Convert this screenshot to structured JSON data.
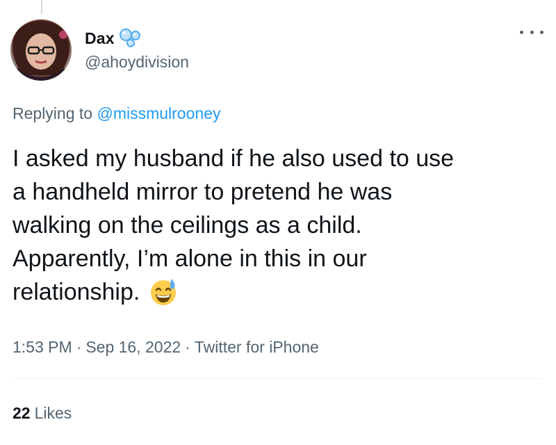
{
  "tweet": {
    "author": {
      "display_name": "Dax",
      "handle": "@ahoydivision",
      "name_emoji": "bubbles-emoji"
    },
    "more_icon": "more-horizontal-icon",
    "reply": {
      "prefix": "Replying to",
      "mention": "@missmulrooney"
    },
    "text_lines": [
      "I asked my husband if he also used to use",
      "a handheld mirror to pretend he was",
      "walking on the ceilings as a child.",
      "Apparently, I’m alone in this in our",
      "relationship."
    ],
    "text_emoji": "grinning-face-with-sweat-emoji",
    "meta": {
      "time": "1:53 PM",
      "separator": "·",
      "date": "Sep 16, 2022",
      "source": "Twitter for iPhone"
    },
    "likes": {
      "count": "22",
      "label": "Likes"
    }
  },
  "colors": {
    "text_primary": "#0f1419",
    "text_secondary": "#536471",
    "link": "#1d9bf0",
    "divider": "#eff3f4"
  }
}
